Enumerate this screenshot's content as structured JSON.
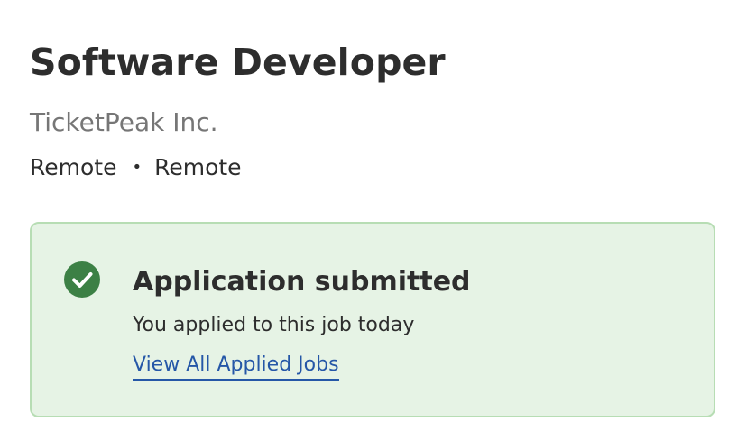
{
  "job": {
    "title": "Software Developer",
    "company": "TicketPeak Inc.",
    "location": "Remote",
    "work_type": "Remote",
    "separator": "•"
  },
  "status": {
    "icon": "check-circle-icon",
    "title": "Application submitted",
    "subtitle": "You applied to this job today",
    "link_label": "View All Applied Jobs",
    "accent_color": "#3c8045",
    "background_color": "#e6f3e5",
    "border_color": "#b7ddb4",
    "link_color": "#2557a7"
  }
}
